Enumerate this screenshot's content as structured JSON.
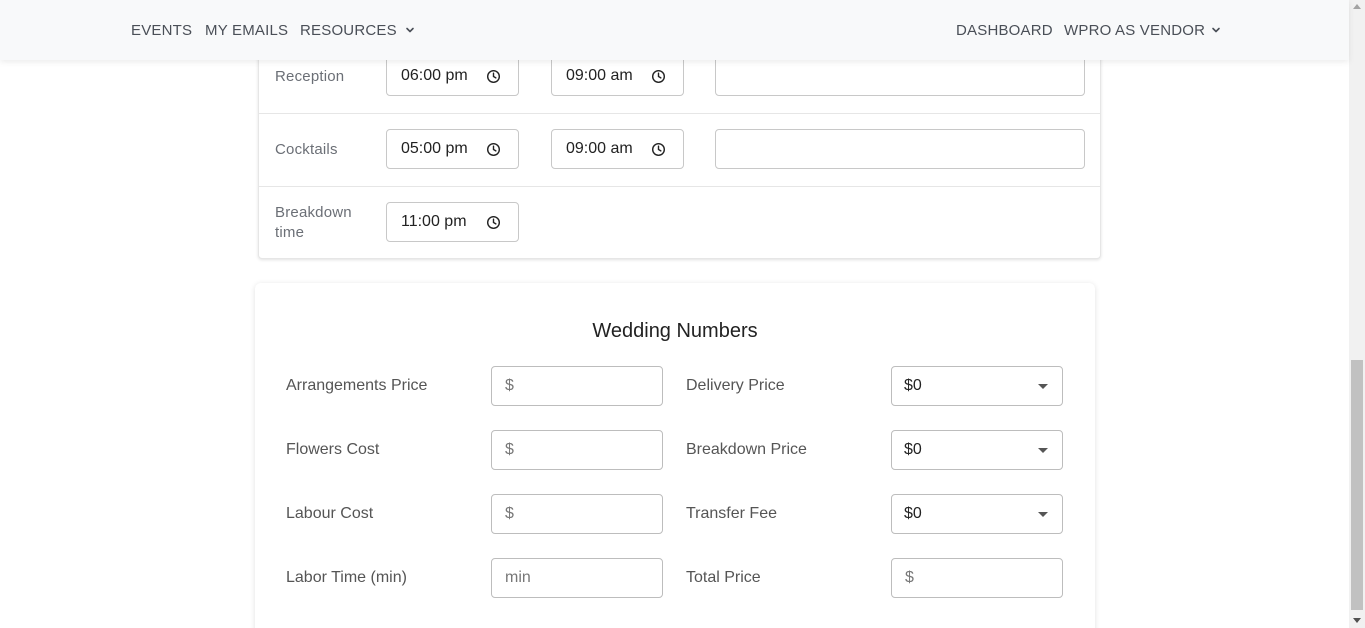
{
  "nav": {
    "events": "EVENTS",
    "my_emails": "MY EMAILS",
    "resources": "RESOURCES",
    "dashboard": "DASHBOARD",
    "vendor": "WPRO AS VENDOR"
  },
  "schedule": {
    "rows": [
      {
        "label": "Reception",
        "start": "06:00 pm",
        "end": "09:00 am"
      },
      {
        "label": "Cocktails",
        "start": "05:00 pm",
        "end": "09:00 am"
      },
      {
        "label_line1": "Breakdown",
        "label_line2": "time",
        "start": "11:00 pm"
      }
    ]
  },
  "numbers": {
    "title": "Wedding Numbers",
    "left": [
      {
        "label": "Arrangements Price",
        "placeholder": "$"
      },
      {
        "label": "Flowers Cost",
        "placeholder": "$"
      },
      {
        "label": "Labour Cost",
        "placeholder": "$"
      },
      {
        "label": "Labor Time (min)",
        "placeholder": "min"
      }
    ],
    "right": [
      {
        "label": "Delivery Price",
        "value": "$0"
      },
      {
        "label": "Breakdown Price",
        "value": "$0"
      },
      {
        "label": "Transfer Fee",
        "value": "$0"
      },
      {
        "label": "Total Price",
        "placeholder": "$"
      }
    ]
  }
}
